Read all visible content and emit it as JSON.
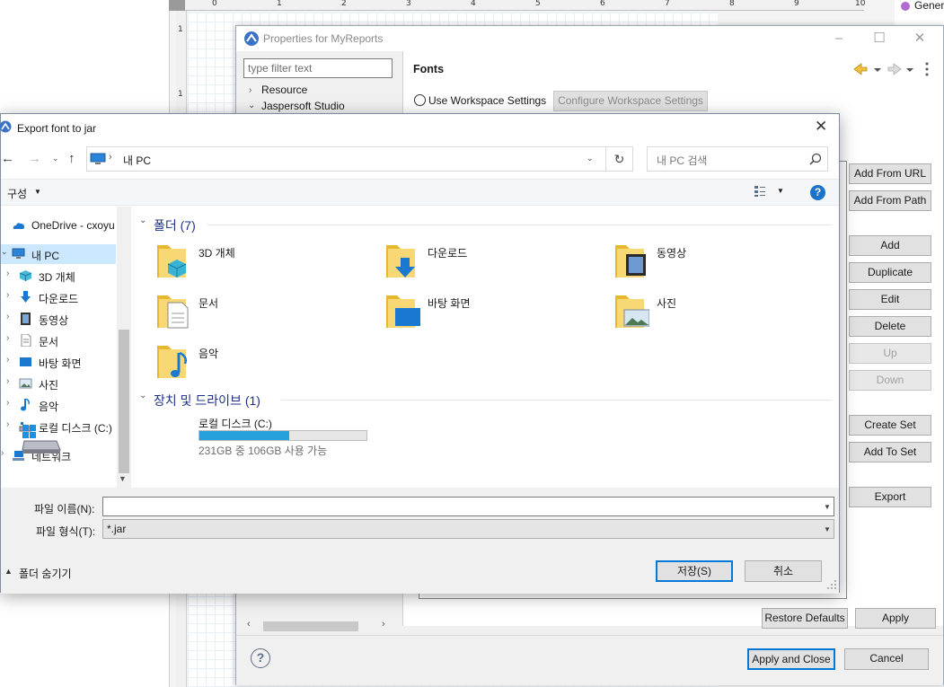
{
  "background": {
    "ruler_ticks": [
      "0",
      "1",
      "2",
      "3",
      "4",
      "5",
      "6",
      "7",
      "8",
      "9",
      "10"
    ],
    "vruler_ticks": [
      "1",
      "1"
    ],
    "outline_label": "Gener"
  },
  "properties": {
    "title": "Properties for MyReports",
    "filter_placeholder": "type filter text",
    "tree": [
      {
        "label": "Resource",
        "expanded": false
      },
      {
        "label": "Jaspersoft Studio",
        "expanded": true
      }
    ],
    "page_title": "Fonts",
    "use_workspace_label": "Use Workspace Settings",
    "configure_workspace_label": "Configure Workspace Settings",
    "side_buttons": {
      "add_from_url": "Add From URL",
      "add_from_path": "Add From Path",
      "add": "Add",
      "duplicate": "Duplicate",
      "edit": "Edit",
      "delete": "Delete",
      "up": "Up",
      "down": "Down",
      "create_set": "Create Set",
      "add_to_set": "Add To Set",
      "export": "Export"
    },
    "restore_defaults": "Restore Defaults",
    "apply": "Apply",
    "apply_and_close": "Apply and Close",
    "cancel": "Cancel",
    "help_glyph": "?"
  },
  "export_dialog": {
    "title": "Export font to jar",
    "address": "내 PC",
    "search_placeholder": "내 PC 검색",
    "organize": "구성",
    "nav": [
      {
        "label": "OneDrive - cxoyu",
        "icon": "onedrive-icon",
        "selected": false,
        "indent": 0
      },
      {
        "label": "내 PC",
        "icon": "pc-icon",
        "selected": true,
        "indent": 0
      },
      {
        "label": "3D 개체",
        "icon": "3d-objects-icon",
        "selected": false,
        "indent": 1
      },
      {
        "label": "다운로드",
        "icon": "download-icon",
        "selected": false,
        "indent": 1
      },
      {
        "label": "동영상",
        "icon": "video-icon",
        "selected": false,
        "indent": 1
      },
      {
        "label": "문서",
        "icon": "document-icon",
        "selected": false,
        "indent": 1
      },
      {
        "label": "바탕 화면",
        "icon": "desktop-icon",
        "selected": false,
        "indent": 1
      },
      {
        "label": "사진",
        "icon": "picture-icon",
        "selected": false,
        "indent": 1
      },
      {
        "label": "음악",
        "icon": "music-icon",
        "selected": false,
        "indent": 1
      },
      {
        "label": "로컬 디스크 (C:)",
        "icon": "drive-icon",
        "selected": false,
        "indent": 1
      },
      {
        "label": "네트워크",
        "icon": "network-icon",
        "selected": false,
        "indent": 0
      }
    ],
    "folders_header": "폴더 (7)",
    "folders": [
      {
        "label": "3D 개체",
        "icon": "3d-objects-folder-icon"
      },
      {
        "label": "다운로드",
        "icon": "download-folder-icon"
      },
      {
        "label": "동영상",
        "icon": "video-folder-icon"
      },
      {
        "label": "문서",
        "icon": "document-folder-icon"
      },
      {
        "label": "바탕 화면",
        "icon": "desktop-folder-icon"
      },
      {
        "label": "사진",
        "icon": "picture-folder-icon"
      },
      {
        "label": "음악",
        "icon": "music-folder-icon"
      }
    ],
    "drives_header": "장치 및 드라이브 (1)",
    "drive": {
      "label": "로컬 디스크 (C:)",
      "free_text": "231GB 중 106GB 사용 가능",
      "used_fraction": 0.54
    },
    "file_name_label": "파일 이름(N):",
    "file_name_value": "",
    "file_type_label": "파일 형식(T):",
    "file_type_value": "*.jar",
    "hide_folders": "폴더 숨기기",
    "save": "저장(S)",
    "cancel": "취소"
  },
  "colors": {
    "accent": "#0078d7",
    "selection": "#cce8ff",
    "group_header": "#1e3287",
    "progress": "#26a0da"
  }
}
